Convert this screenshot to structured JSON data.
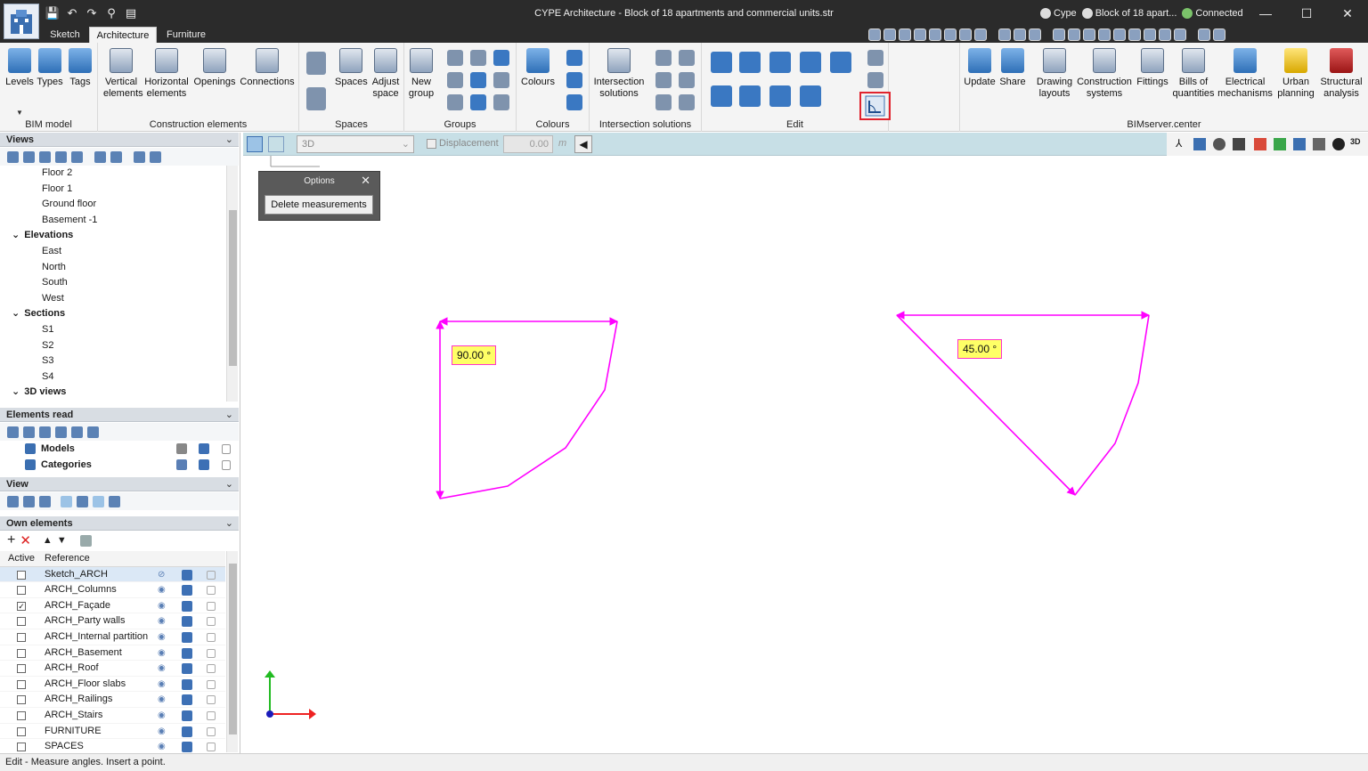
{
  "window": {
    "title": "CYPE Architecture - Block of 18 apartments and commercial units.str",
    "account": "Cype",
    "project_short": "Block of 18 apart...",
    "connection": "Connected"
  },
  "tabs": [
    "Sketch",
    "Architecture",
    "Furniture"
  ],
  "ribbon": {
    "bim_model": {
      "label": "BIM model",
      "buttons": [
        "Levels",
        "Types",
        "Tags"
      ]
    },
    "construction": {
      "label": "Construction elements",
      "vertical": "Vertical elements",
      "horizontal": "Horizontal elements",
      "openings": "Openings",
      "connections": "Connections"
    },
    "spaces": {
      "label": "Spaces",
      "spaces": "Spaces",
      "adjust": "Adjust space"
    },
    "groups": {
      "label": "Groups",
      "new": "New group"
    },
    "colours": {
      "label": "Colours",
      "colours": "Colours"
    },
    "intersection": {
      "label": "Intersection solutions",
      "btn": "Intersection solutions"
    },
    "edit": {
      "label": "Edit"
    },
    "bimserver": {
      "label": "BIMserver.center",
      "update": "Update",
      "share": "Share",
      "drawing": "Drawing layouts",
      "construction": "Construction systems",
      "fittings": "Fittings",
      "bills": "Bills of quantities",
      "electrical": "Electrical mechanisms",
      "urban": "Urban planning",
      "structural": "Structural analysis"
    }
  },
  "views": {
    "title": "Views",
    "items": [
      {
        "label": "Floor 2",
        "level": 2
      },
      {
        "label": "Floor 1",
        "level": 2
      },
      {
        "label": "Ground floor",
        "level": 2
      },
      {
        "label": "Basement -1",
        "level": 2
      },
      {
        "label": "Elevations",
        "level": 1
      },
      {
        "label": "East",
        "level": 2
      },
      {
        "label": "North",
        "level": 2
      },
      {
        "label": "South",
        "level": 2
      },
      {
        "label": "West",
        "level": 2
      },
      {
        "label": "Sections",
        "level": 1
      },
      {
        "label": "S1",
        "level": 2
      },
      {
        "label": "S2",
        "level": 2
      },
      {
        "label": "S3",
        "level": 2
      },
      {
        "label": "S4",
        "level": 2
      },
      {
        "label": "3D views",
        "level": 1
      }
    ]
  },
  "elements_read": {
    "title": "Elements read",
    "models": "Models",
    "categories": "Categories"
  },
  "view_panel": {
    "title": "View"
  },
  "own_elements": {
    "title": "Own elements",
    "col_active": "Active",
    "col_reference": "Reference",
    "rows": [
      {
        "name": "Sketch_ARCH",
        "checked": false
      },
      {
        "name": "ARCH_Columns",
        "checked": false
      },
      {
        "name": "ARCH_Façade",
        "checked": true
      },
      {
        "name": "ARCH_Party walls",
        "checked": false
      },
      {
        "name": "ARCH_Internal partition",
        "checked": false
      },
      {
        "name": "ARCH_Basement",
        "checked": false
      },
      {
        "name": "ARCH_Roof",
        "checked": false
      },
      {
        "name": "ARCH_Floor slabs",
        "checked": false
      },
      {
        "name": "ARCH_Railings",
        "checked": false
      },
      {
        "name": "ARCH_Stairs",
        "checked": false
      },
      {
        "name": "FURNITURE",
        "checked": false
      },
      {
        "name": "SPACES",
        "checked": false
      }
    ]
  },
  "view_toolbar": {
    "view_select": "3D",
    "displacement_label": "Displacement",
    "displacement_value": "0.00",
    "unit": "m"
  },
  "options": {
    "title": "Options",
    "delete": "Delete measurements"
  },
  "measurements": [
    "90.00 °",
    "45.00 °"
  ],
  "status": "Edit - Measure angles. Insert a point."
}
